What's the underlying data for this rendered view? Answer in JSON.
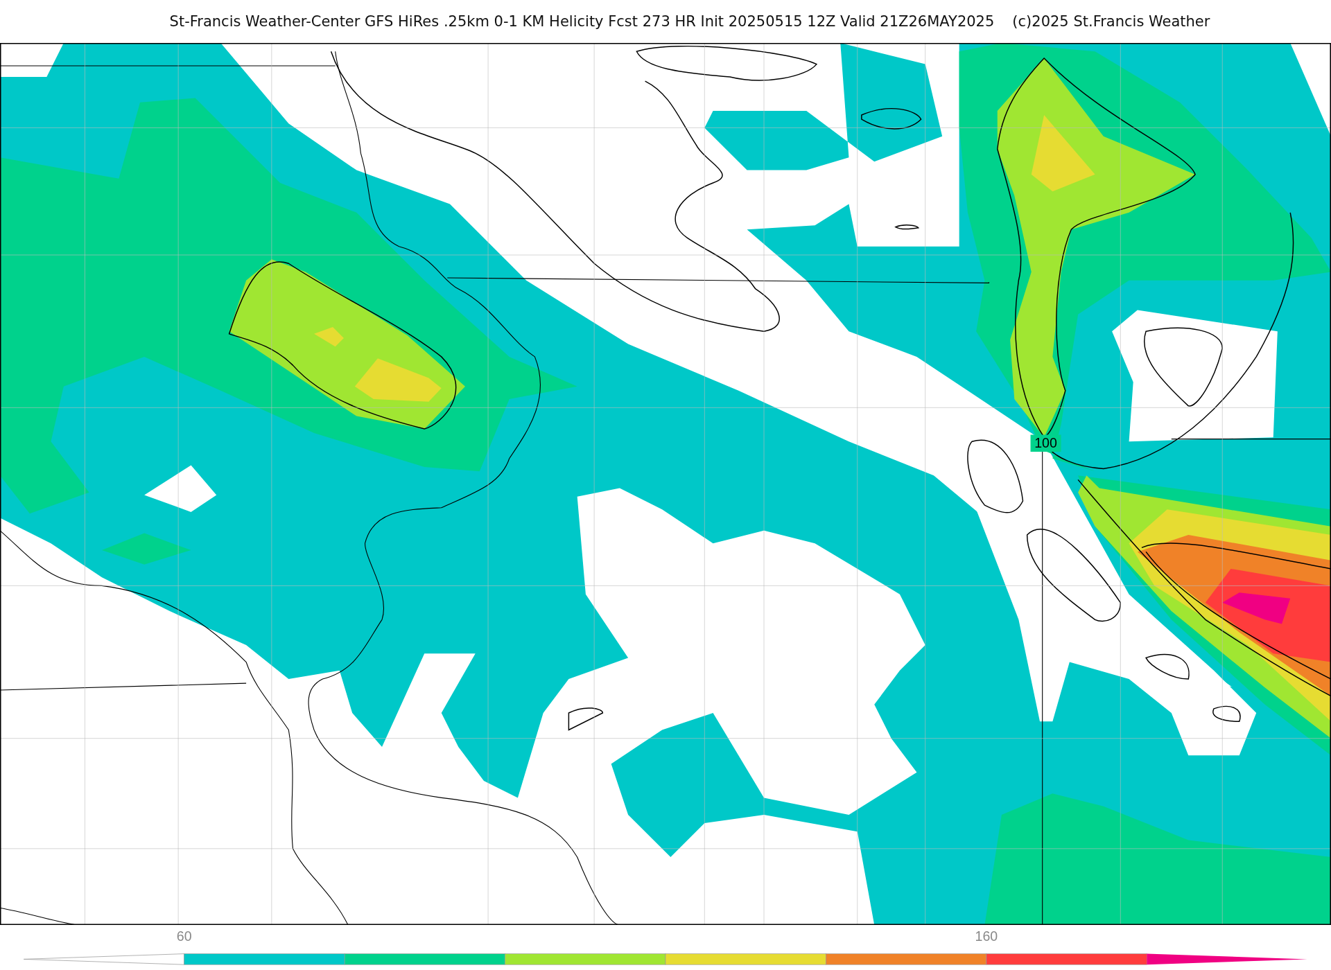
{
  "title": "St-Francis Weather-Center GFS HiRes .25km 0-1 KM Helicity Fcst 273 HR Init 20250515 12Z  Valid 21Z26MAY2025",
  "credit": "(c)2025 St.Francis Weather",
  "map": {
    "contour_label": "100"
  },
  "colorbar": {
    "segments": [
      {
        "color": "#00c8c8",
        "label": "60"
      },
      {
        "color": "#00d28c"
      },
      {
        "color": "#a0e632"
      },
      {
        "color": "#e6dc32"
      },
      {
        "color": "#f08228"
      },
      {
        "color": "#ff3c3c",
        "label": "160"
      },
      {
        "color": "#f00082"
      }
    ]
  }
}
